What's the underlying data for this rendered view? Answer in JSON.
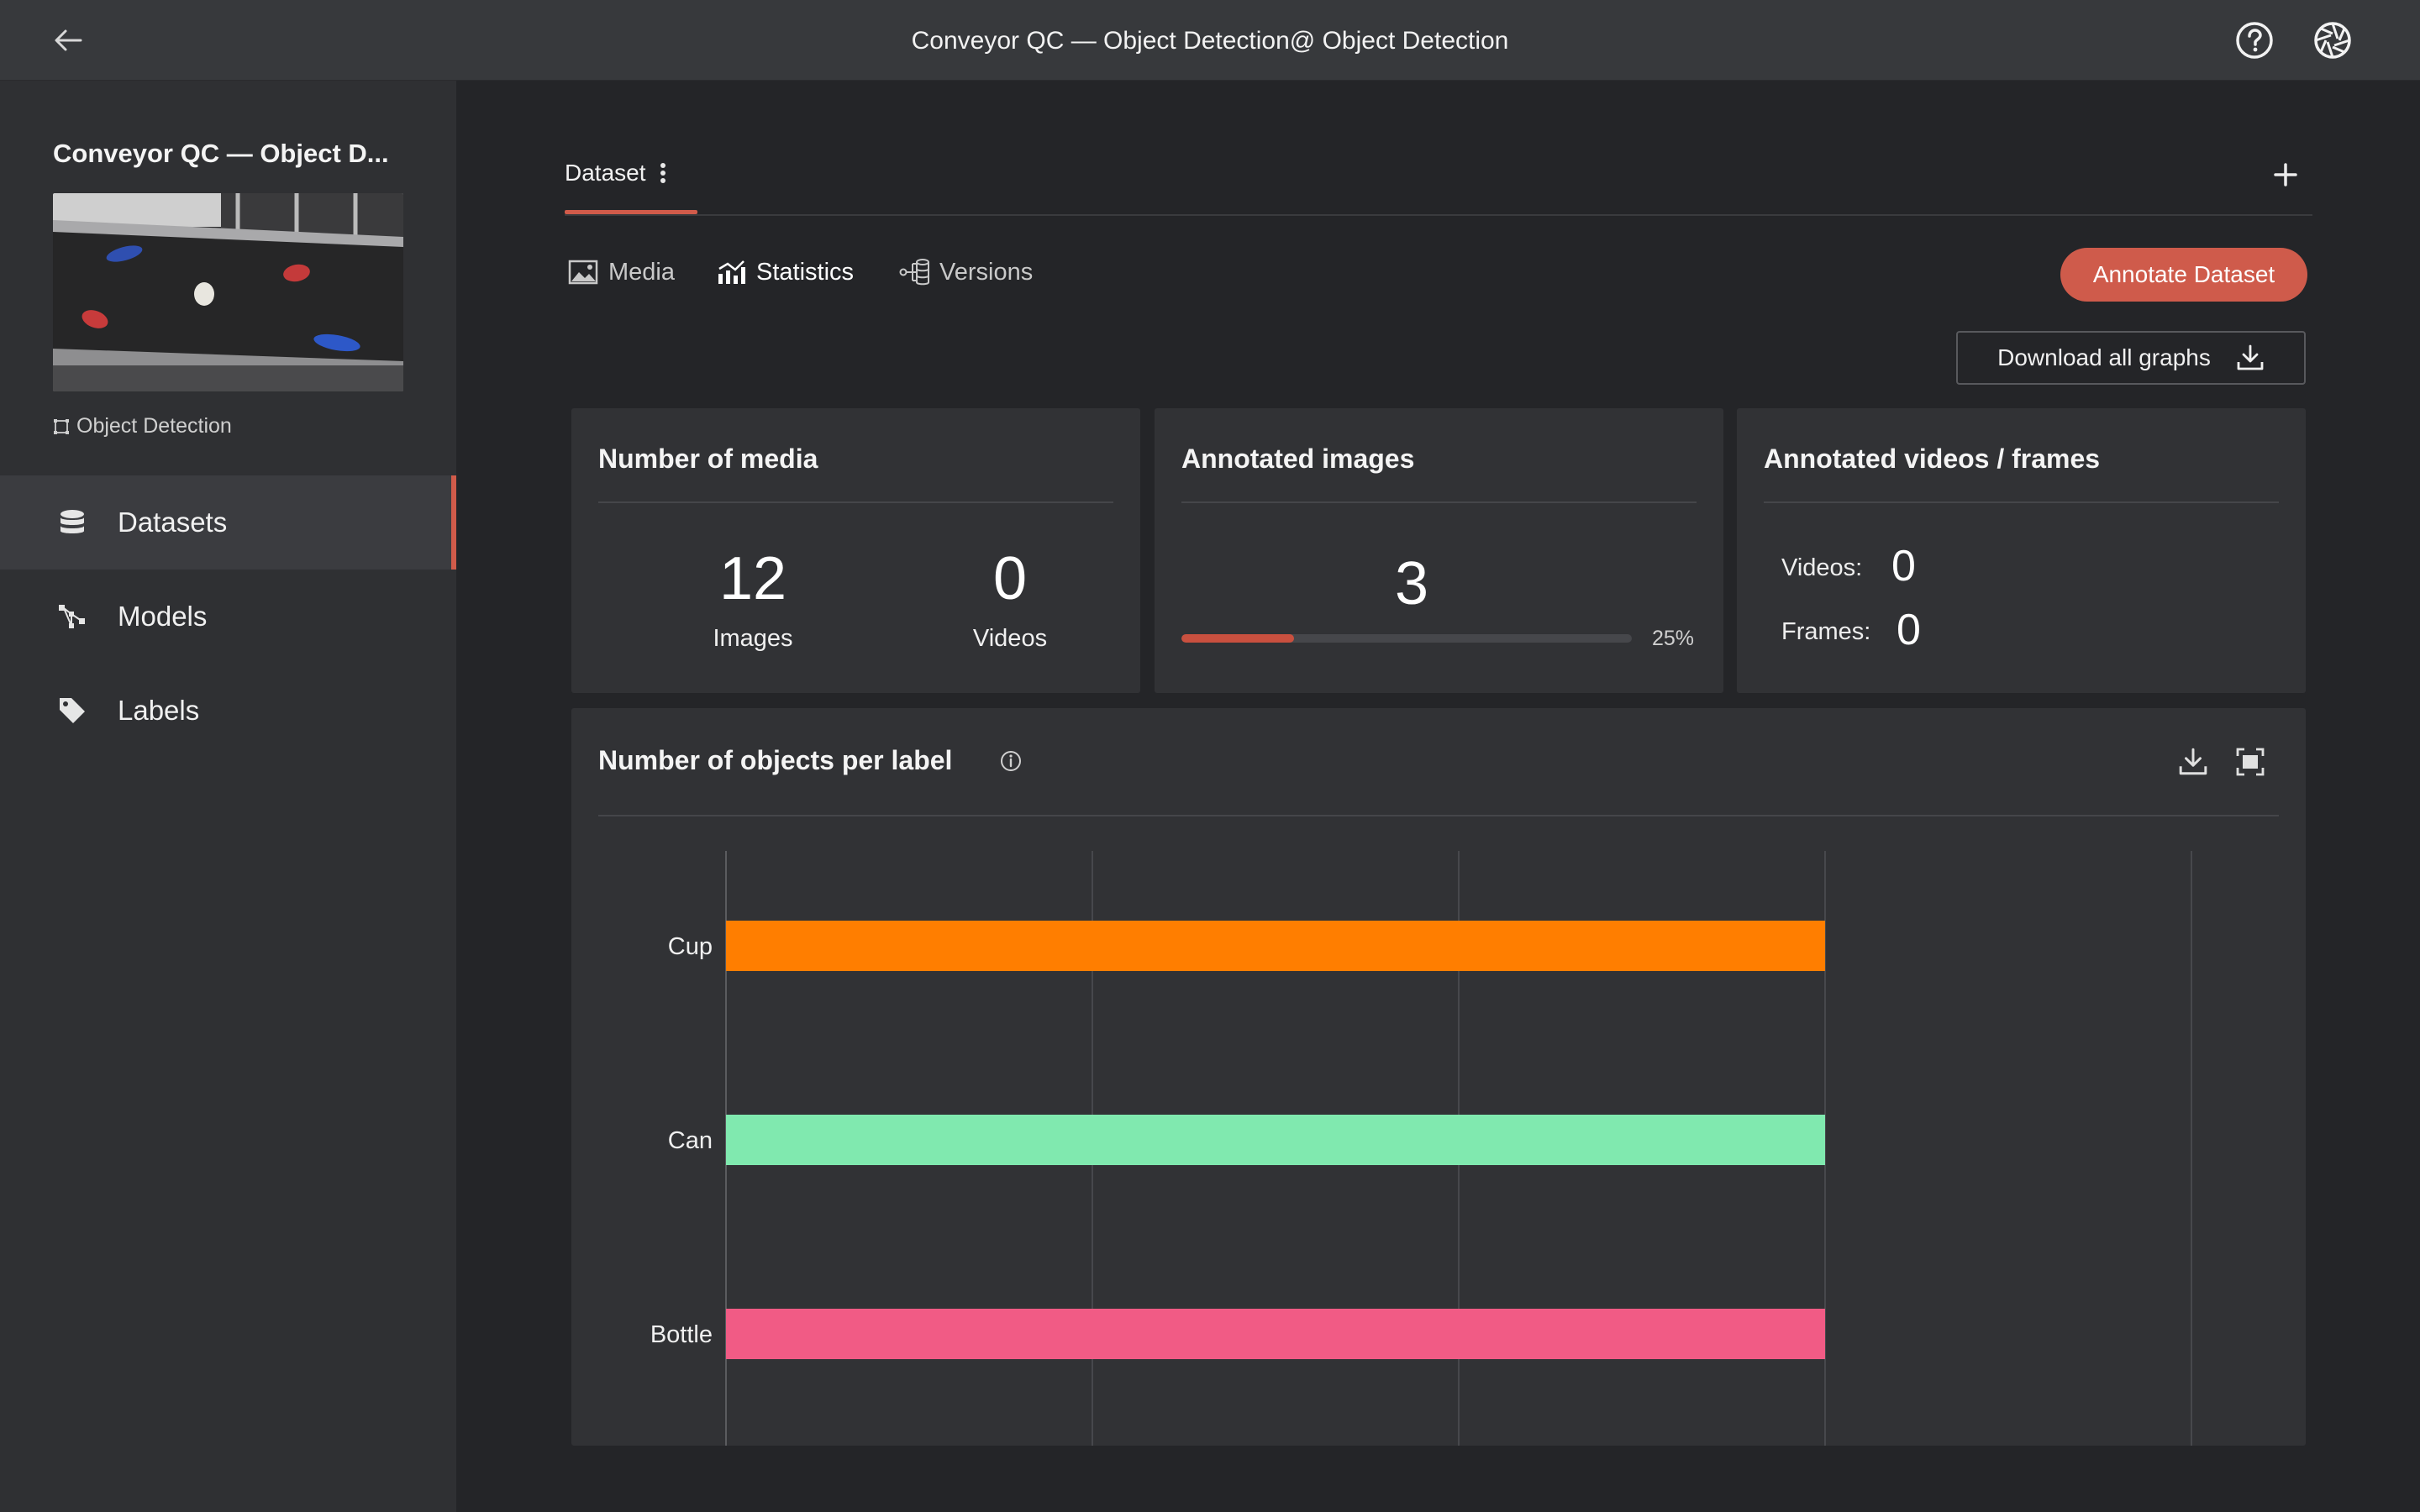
{
  "header": {
    "title": "Conveyor QC — Object Detection@ Object Detection",
    "back_icon": "arrow-left-icon",
    "help_icon": "question-circle-icon",
    "aperture_icon": "aperture-icon"
  },
  "sidebar": {
    "project_name": "Conveyor QC — Object D...",
    "project_type": "Object Detection",
    "items": [
      {
        "label": "Datasets",
        "icon": "database-icon",
        "active": true
      },
      {
        "label": "Models",
        "icon": "models-icon",
        "active": false
      },
      {
        "label": "Labels",
        "icon": "tag-icon",
        "active": false
      }
    ]
  },
  "dataset_tab": {
    "label": "Dataset"
  },
  "subtabs": [
    {
      "label": "Media",
      "icon": "image-icon",
      "active": false
    },
    {
      "label": "Statistics",
      "icon": "statistics-icon",
      "active": true
    },
    {
      "label": "Versions",
      "icon": "versions-icon",
      "active": false
    }
  ],
  "actions": {
    "annotate_label": "Annotate Dataset",
    "download_label": "Download all graphs"
  },
  "cards": {
    "media": {
      "title": "Number of media",
      "images_count": "12",
      "images_label": "Images",
      "videos_count": "0",
      "videos_label": "Videos"
    },
    "annotated_images": {
      "title": "Annotated images",
      "count": "3",
      "percent_text": "25%",
      "progress_fraction": 0.25
    },
    "annotated_videos": {
      "title": "Annotated videos / frames",
      "videos_label": "Videos:",
      "videos_value": "0",
      "frames_label": "Frames:",
      "frames_value": "0"
    }
  },
  "colors": {
    "accent": "#cf5b4b",
    "cup": "#ff7e00",
    "can": "#80e9af",
    "bottle": "#f15b85"
  },
  "chart_data": {
    "type": "bar",
    "orientation": "horizontal",
    "title": "Number of objects per label",
    "categories": [
      "Cup",
      "Can",
      "Bottle"
    ],
    "values": [
      3,
      3,
      3
    ],
    "colors": [
      "#ff7e00",
      "#80e9af",
      "#f15b85"
    ],
    "xlim": [
      0,
      4
    ],
    "xticks": [
      0,
      1,
      2,
      3,
      4
    ],
    "grid": true
  }
}
